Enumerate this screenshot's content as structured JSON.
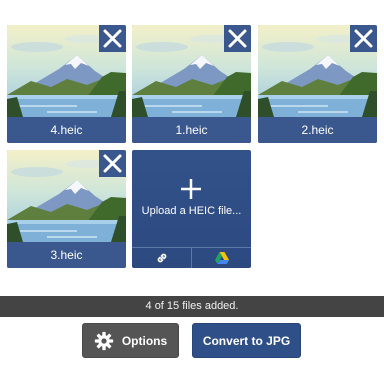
{
  "files": [
    {
      "name": "4.heic"
    },
    {
      "name": "1.heic"
    },
    {
      "name": "2.heic"
    },
    {
      "name": "3.heic"
    }
  ],
  "upload": {
    "label": "Upload a HEIC file..."
  },
  "status": {
    "text": "4 of 15 files added."
  },
  "actions": {
    "options_label": "Options",
    "convert_label": "Convert to JPG"
  },
  "colors": {
    "card_blue": "#3a588e",
    "status_bg": "#444444",
    "options_bg": "#555555",
    "convert_bg": "#2f4f88"
  },
  "icons": {
    "remove": "close-icon",
    "add": "plus-icon",
    "link": "link-icon",
    "drive": "google-drive-icon",
    "options": "gear-icon"
  }
}
